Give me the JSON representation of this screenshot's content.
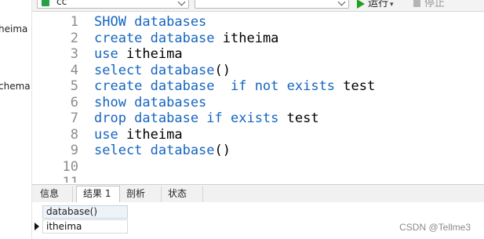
{
  "navigator": {
    "items": [
      "heima",
      "chema"
    ]
  },
  "toolbar": {
    "database_combo_value": "cc",
    "schema_combo_value": "",
    "run_label": "运行",
    "stop_label": "停止"
  },
  "editor": {
    "lines": [
      {
        "no": "1",
        "segments": [
          {
            "t": "SHOW databases",
            "kw": true
          }
        ]
      },
      {
        "no": "2",
        "segments": [
          {
            "t": "create database",
            "kw": true
          },
          {
            "t": " itheima",
            "kw": false
          }
        ]
      },
      {
        "no": "3",
        "segments": [
          {
            "t": "use",
            "kw": true
          },
          {
            "t": " itheima",
            "kw": false
          }
        ]
      },
      {
        "no": "4",
        "segments": [
          {
            "t": "select database",
            "kw": true
          },
          {
            "t": "()",
            "kw": false
          }
        ]
      },
      {
        "no": "5",
        "segments": [
          {
            "t": "create database  if not exists",
            "kw": true
          },
          {
            "t": " test",
            "kw": false
          }
        ]
      },
      {
        "no": "6",
        "segments": [
          {
            "t": "show databases",
            "kw": true
          }
        ]
      },
      {
        "no": "7",
        "segments": [
          {
            "t": "drop database if exists",
            "kw": true
          },
          {
            "t": " test",
            "kw": false
          }
        ]
      },
      {
        "no": "8",
        "segments": [
          {
            "t": "use",
            "kw": true
          },
          {
            "t": " itheima",
            "kw": false
          }
        ]
      },
      {
        "no": "9",
        "segments": [
          {
            "t": "select database",
            "kw": true
          },
          {
            "t": "()",
            "kw": false
          }
        ]
      },
      {
        "no": "10",
        "segments": []
      },
      {
        "no": "11",
        "segments": []
      }
    ]
  },
  "tabs": [
    {
      "label": "信息",
      "active": false
    },
    {
      "label": "结果 1",
      "active": true
    },
    {
      "label": "剖析",
      "active": false
    },
    {
      "label": "状态",
      "active": false
    }
  ],
  "result": {
    "column_header": "database()",
    "rows": [
      "itheima"
    ]
  },
  "watermark": "CSDN @Tellme3",
  "colors": {
    "keyword": "#1565c0",
    "line_number": "#8c8c8c",
    "run_icon": "#20a020"
  }
}
